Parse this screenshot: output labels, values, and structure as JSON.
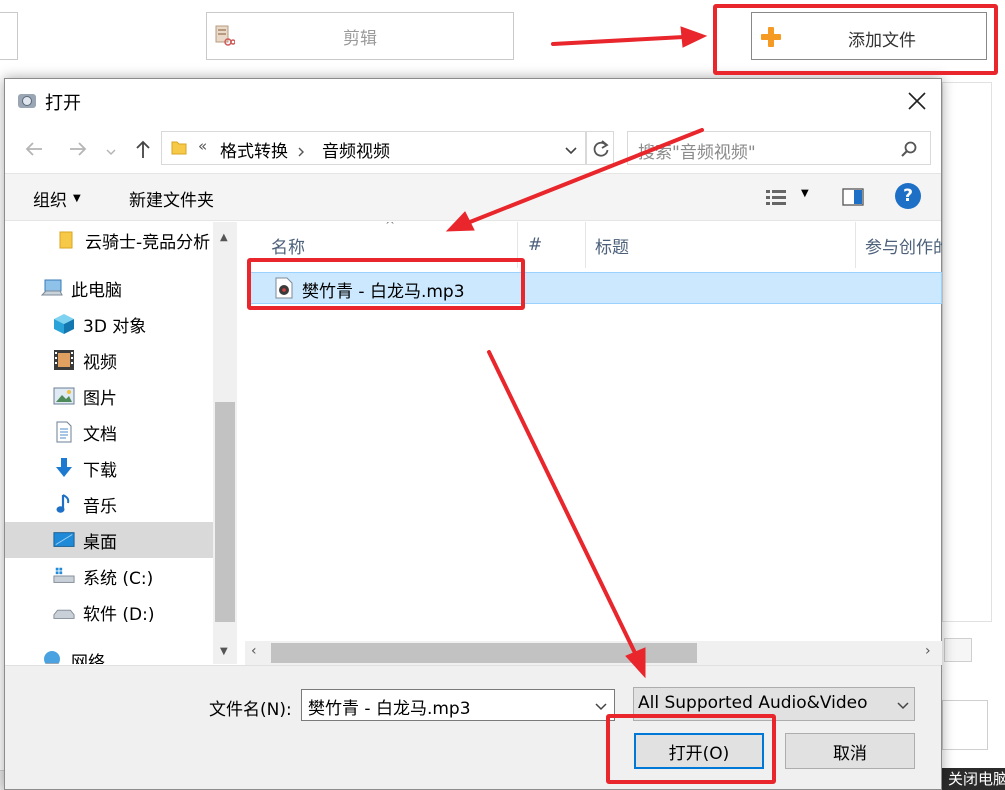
{
  "app": {
    "clip_label": "剪辑",
    "add_file_label": "添加文件",
    "close_partial": "关闭电脑"
  },
  "dialog": {
    "title": "打开",
    "breadcrumb": {
      "overflow": "«",
      "items": [
        "格式转换",
        "音频视频"
      ]
    },
    "search_placeholder": "搜索\"音频视频\"",
    "organize_label": "组织",
    "new_folder_label": "新建文件夹",
    "sidebar": {
      "items": [
        {
          "label": "云骑士-竞品分析",
          "icon": "folder-icon"
        },
        {
          "label": "此电脑",
          "icon": "computer-icon"
        },
        {
          "label": "3D 对象",
          "icon": "cube-icon"
        },
        {
          "label": "视频",
          "icon": "film-icon"
        },
        {
          "label": "图片",
          "icon": "picture-icon"
        },
        {
          "label": "文档",
          "icon": "document-icon"
        },
        {
          "label": "下载",
          "icon": "download-icon"
        },
        {
          "label": "音乐",
          "icon": "music-icon"
        },
        {
          "label": "桌面",
          "icon": "desktop-icon",
          "selected": true
        },
        {
          "label": "系统 (C:)",
          "icon": "drive-icon"
        },
        {
          "label": "软件 (D:)",
          "icon": "drive-icon"
        },
        {
          "label": "网络",
          "icon": "network-icon"
        }
      ]
    },
    "columns": [
      "名称",
      "#",
      "标题",
      "参与创作的"
    ],
    "files": [
      {
        "name": "樊竹青 - 白龙马.mp3",
        "selected": true
      }
    ],
    "filename_label": "文件名(N):",
    "filename_value": "樊竹青 - 白龙马.mp3",
    "filetype_value": "All Supported Audio&Video",
    "open_label": "打开(O)",
    "cancel_label": "取消"
  },
  "colors": {
    "annotation": "#e8262c",
    "selection": "#cce8ff",
    "help": "#1e70c6"
  }
}
